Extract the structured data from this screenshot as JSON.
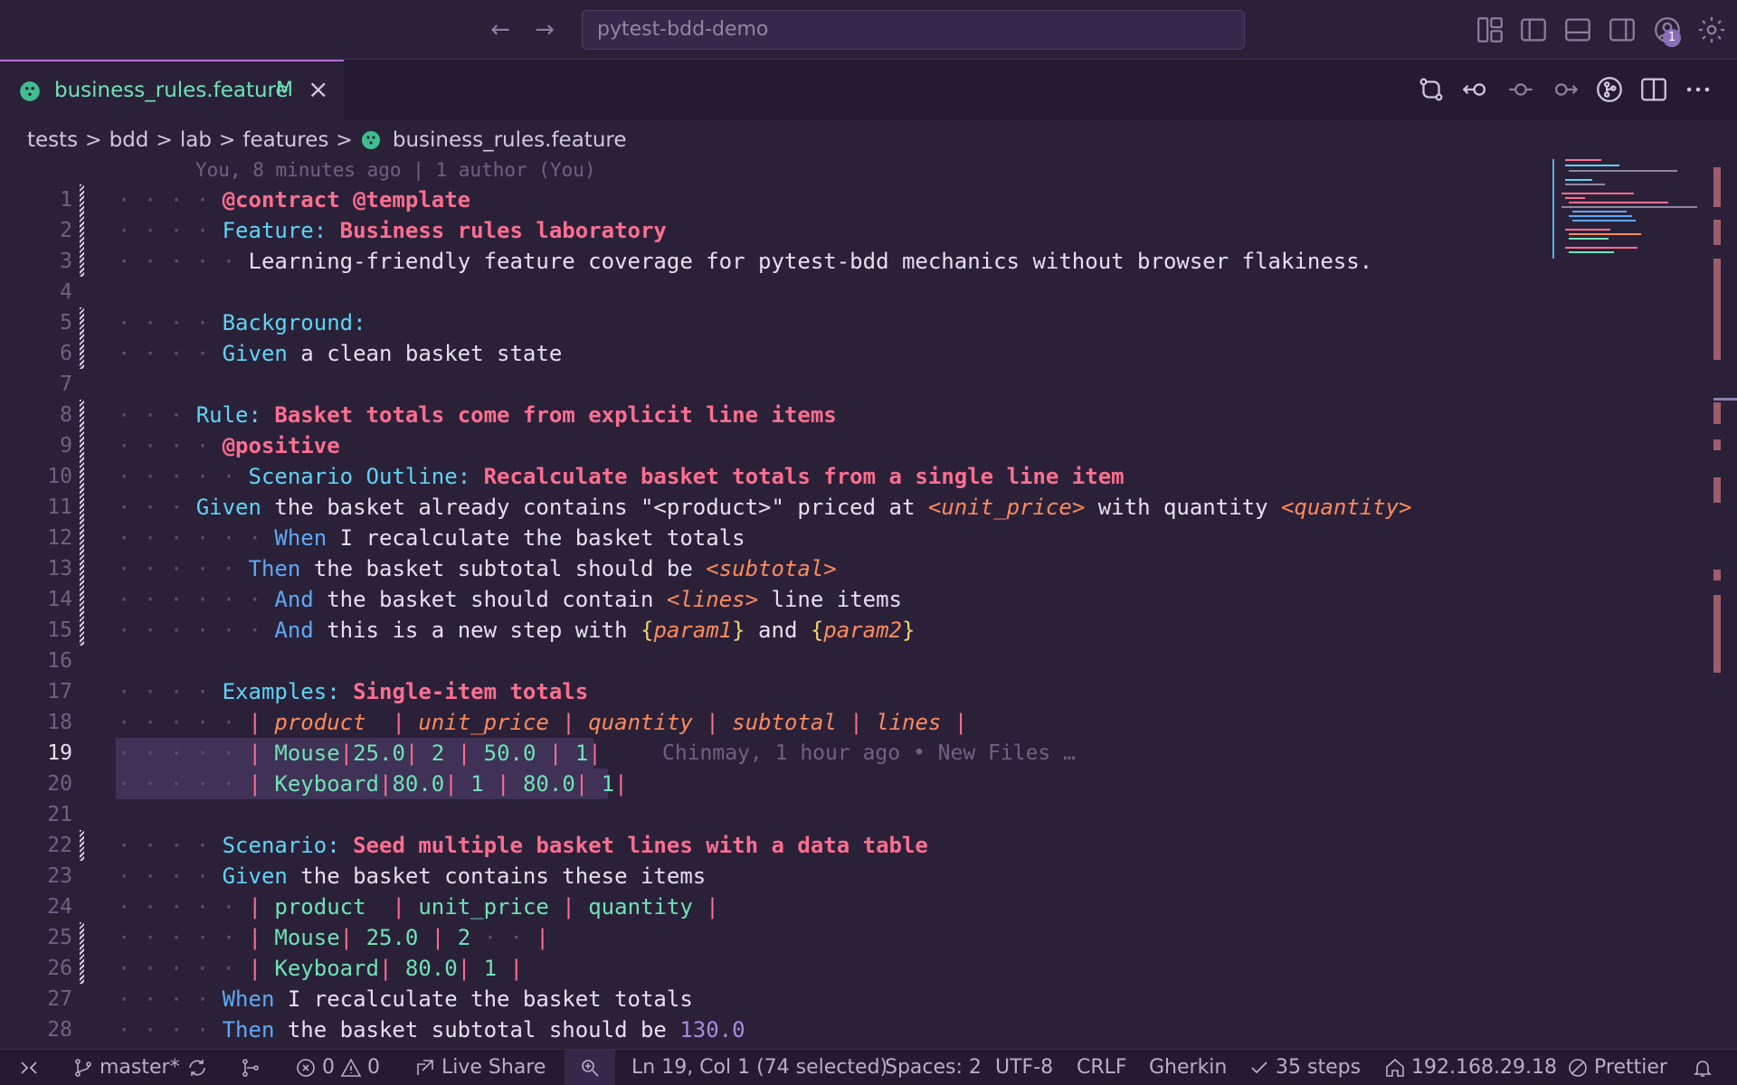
{
  "titlebar": {
    "search_value": "pytest-bdd-demo",
    "back_icon": "arrow-left-icon",
    "forward_icon": "arrow-right-icon",
    "accounts_badge": "1"
  },
  "tab": {
    "filename": "business_rules.feature",
    "modified": "M",
    "close": "×"
  },
  "breadcrumb": {
    "items": [
      "tests",
      "bdd",
      "lab",
      "features"
    ],
    "file": "business_rules.feature",
    "separator": ">"
  },
  "editor": {
    "blame_header": "You, 8 minutes ago | 1 author (You)",
    "inline_blame": "Chinmay, 1 hour ago • New Files …",
    "line_numbers": [
      "1",
      "2",
      "3",
      "4",
      "5",
      "6",
      "7",
      "8",
      "9",
      "10",
      "11",
      "12",
      "13",
      "14",
      "15",
      "16",
      "17",
      "18",
      "19",
      "20",
      "21",
      "22",
      "23",
      "24",
      "25",
      "26",
      "27",
      "28"
    ],
    "l1": {
      "tags": "@contract @template"
    },
    "l2": {
      "kw": "Feature:",
      "title": "Business rules laboratory"
    },
    "l3": {
      "text": "Learning-friendly feature coverage for pytest-bdd mechanics without browser flakiness."
    },
    "l5": {
      "kw": "Background:"
    },
    "l6": {
      "step": "Given",
      "text": " a clean basket state"
    },
    "l8": {
      "kw": "Rule:",
      "title": "Basket totals come from explicit line items"
    },
    "l9": {
      "tag": "@positive"
    },
    "l10": {
      "kw": "Scenario Outline:",
      "title": "Recalculate basket totals from a single line item"
    },
    "l11": {
      "step": "Given",
      "t1": " the basket already contains \"<product>\" priced at ",
      "p1": "<unit_price>",
      "t2": " with quantity ",
      "p2": "<quantity>"
    },
    "l12": {
      "step": "When",
      "text": " I recalculate the basket totals"
    },
    "l13": {
      "step": "Then",
      "text": " the basket subtotal should be ",
      "p1": "<subtotal>"
    },
    "l14": {
      "step": "And",
      "text": " the basket should contain ",
      "p1": "<lines>",
      "t2": " line items"
    },
    "l15": {
      "step": "And",
      "text": " this is a new step with ",
      "p1": "param1",
      "t2": " and ",
      "p2": "param2"
    },
    "l17": {
      "kw": "Examples:",
      "title": "Single-item totals"
    },
    "l18": {
      "cells": [
        "product ",
        "unit_price",
        "quantity",
        "subtotal",
        "lines"
      ]
    },
    "l19": {
      "cells": [
        "Mouse",
        "25.0",
        "2",
        "50.0",
        "1"
      ]
    },
    "l20": {
      "cells": [
        "Keyboard",
        "80.0",
        "1",
        "80.0",
        "1"
      ]
    },
    "l22": {
      "kw": "Scenario:",
      "title": "Seed multiple basket lines with a data table"
    },
    "l23": {
      "step": "Given",
      "text": " the basket contains these items"
    },
    "l24": {
      "cells": [
        "product ",
        "unit_price",
        "quantity"
      ]
    },
    "l25": {
      "cells": [
        "Mouse",
        "25.0",
        "2"
      ]
    },
    "l26": {
      "cells": [
        "Keyboard",
        "80.0",
        "1"
      ]
    },
    "l27": {
      "step": "When",
      "text": " I recalculate the basket totals"
    },
    "l28": {
      "step": "Then",
      "text": " the basket subtotal should be ",
      "num": "130.0"
    }
  },
  "statusbar": {
    "branch": "master*",
    "errors": "0",
    "warnings": "0",
    "live_share": "Live Share",
    "cursor": "Ln 19, Col 1 (74 selected)",
    "spaces": "Spaces: 2",
    "encoding": "UTF-8",
    "eol": "CRLF",
    "language": "Gherkin",
    "steps": "35 steps",
    "host": "192.168.29.18",
    "formatter": "Prettier"
  },
  "colors": {
    "background": "#2a2139",
    "accent_tab": "#b46bd6",
    "keyword": "#5fd4f5",
    "title": "#ff6e8f",
    "cell": "#6fe3b5",
    "param": "#ff8a5c"
  }
}
